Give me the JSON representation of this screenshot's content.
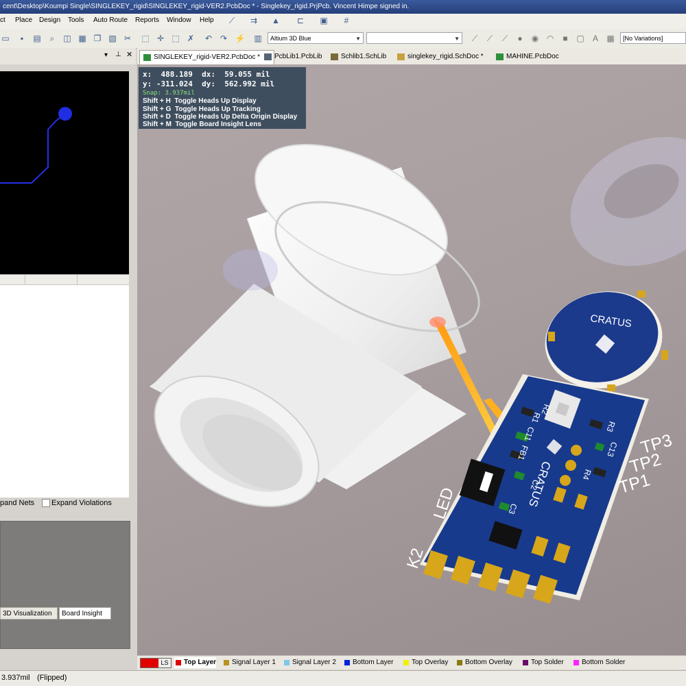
{
  "window": {
    "title": "cent\\Desktop\\Koumpi Single\\SINGLEKEY_rigid\\SINGLEKEY_rigid-VER2.PcbDoc * - Singlekey_rigid.PrjPcb. Vincent Himpe signed in."
  },
  "menu": [
    "ct",
    "Place",
    "Design",
    "Tools",
    "Auto Route",
    "Reports",
    "Window",
    "Help"
  ],
  "toolbar": {
    "view_config": "Altium 3D Blue",
    "variations": "[No Variations]"
  },
  "doc_tabs": [
    {
      "label": "SINGLEKEY_rigid-VER2.PcbDoc *",
      "active": true,
      "color": "#2f8f3e"
    },
    {
      "label": "PcbLib1.PcbLib",
      "active": false,
      "color": "#556677"
    },
    {
      "label": "Schlib1.SchLib",
      "active": false,
      "color": "#7a6a3a"
    },
    {
      "label": "singlekey_rigid.SchDoc *",
      "active": false,
      "color": "#c8a040"
    },
    {
      "label": "MAHINE.PcbDoc",
      "active": false,
      "color": "#2f8f3e"
    }
  ],
  "hud": {
    "x_label": "x:",
    "x_value": "488.189",
    "dx_label": "dx:",
    "dx_value": "59.055 mil",
    "y_label": "y:",
    "y_value": "-311.024",
    "dy_label": "dy:",
    "dy_value": "562.992 mil",
    "snap": "Snap: 3.937mil",
    "shortcuts": [
      {
        "keys": "Shift + H",
        "action": "Toggle Heads Up Display"
      },
      {
        "keys": "Shift + G",
        "action": "Toggle Heads Up Tracking"
      },
      {
        "keys": "Shift + D",
        "action": "Toggle Heads Up Delta Origin Display"
      },
      {
        "keys": "Shift + M",
        "action": "Toggle Board Insight Lens"
      }
    ]
  },
  "board": {
    "logo_text": "CRATUS",
    "silkscreen": [
      "R2",
      "R1",
      "C11",
      "FB1",
      "C2",
      "C3",
      "R3",
      "C13",
      "R4"
    ],
    "test_points": [
      "TP3",
      "TP2",
      "TP1"
    ],
    "key_labels": [
      "K2",
      "LED"
    ]
  },
  "left_panel": {
    "expand_nets": "pand Nets",
    "expand_violations": "Expand Violations",
    "tabs": [
      "3D Visualization",
      "Board Insight"
    ]
  },
  "layers": {
    "current_label": "LS",
    "items": [
      {
        "name": "Top Layer",
        "color": "#e00000",
        "bold": true
      },
      {
        "name": "Signal Layer 1",
        "color": "#b8911f"
      },
      {
        "name": "Signal Layer 2",
        "color": "#7fc7e8"
      },
      {
        "name": "Bottom Layer",
        "color": "#0020e0"
      },
      {
        "name": "Top Overlay",
        "color": "#f0f000"
      },
      {
        "name": "Bottom Overlay",
        "color": "#8a7a10"
      },
      {
        "name": "Top Solder",
        "color": "#6a0a6a"
      },
      {
        "name": "Bottom Solder",
        "color": "#ff20ff"
      }
    ]
  },
  "status": {
    "snap": "3.937mil",
    "mode": "(Flipped)"
  }
}
